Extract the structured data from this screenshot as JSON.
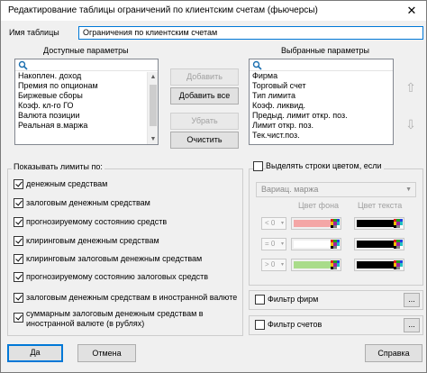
{
  "window": {
    "title": "Редактирование таблицы ограничений по клиентским счетам (фьючерсы)",
    "close_glyph": "✕"
  },
  "table_name": {
    "label": "Имя таблицы",
    "value": "Ограничения по клиентским счетам"
  },
  "available": {
    "header": "Доступные параметры",
    "items": [
      "Накоплен. доход",
      "Премия по опционам",
      "Биржевые сборы",
      "Коэф. кл-го ГО",
      "Валюта позиции",
      "Реальная в.маржа"
    ]
  },
  "selected": {
    "header": "Выбранные параметры",
    "items": [
      "Фирма",
      "Торговый счет",
      "Тип лимита",
      "Коэф. ликвид.",
      "Предыд. лимит откр. поз.",
      "Лимит откр. поз.",
      "Тек.чист.поз."
    ]
  },
  "middle_buttons": {
    "add": "Добавить",
    "add_all": "Добавить все",
    "remove": "Убрать",
    "clear": "Очистить"
  },
  "limits": {
    "header": "Показывать лимиты по:",
    "options": [
      {
        "label": "денежным средствам",
        "checked": true
      },
      {
        "label": "залоговым денежным средствам",
        "checked": true
      },
      {
        "label": "прогнозируемому состоянию средств",
        "checked": true
      },
      {
        "label": "клиринговым денежным средствам",
        "checked": true
      },
      {
        "label": "клиринговым залоговым денежным средствам",
        "checked": true
      },
      {
        "label": "прогнозируемому состоянию залоговых средств",
        "checked": true
      },
      {
        "label": "залоговым денежным средствам в иностранной валюте",
        "checked": true
      },
      {
        "label": "суммарным залоговым денежным средствам в иностранной валюте (в рублях)",
        "checked": true
      }
    ]
  },
  "highlight": {
    "checkbox_label": "Выделять строки цветом, если",
    "checked": false,
    "column_value": "Вариац. маржа",
    "bg_header": "Цвет фона",
    "text_header": "Цвет текста",
    "rows": [
      {
        "op": "< 0",
        "bg": "#f4a6a6",
        "text": "#000000"
      },
      {
        "op": "= 0",
        "bg": "#ffffff",
        "text": "#000000"
      },
      {
        "op": "> 0",
        "bg": "#a9dc8a",
        "text": "#000000"
      }
    ]
  },
  "filters": {
    "firms_label": "Фильтр фирм",
    "accounts_label": "Фильтр счетов",
    "more": "..."
  },
  "bottom": {
    "ok": "Да",
    "cancel": "Отмена",
    "help": "Справка"
  },
  "colors": {
    "accent": "#0078d7",
    "window_bg": "#f0f0f0"
  }
}
